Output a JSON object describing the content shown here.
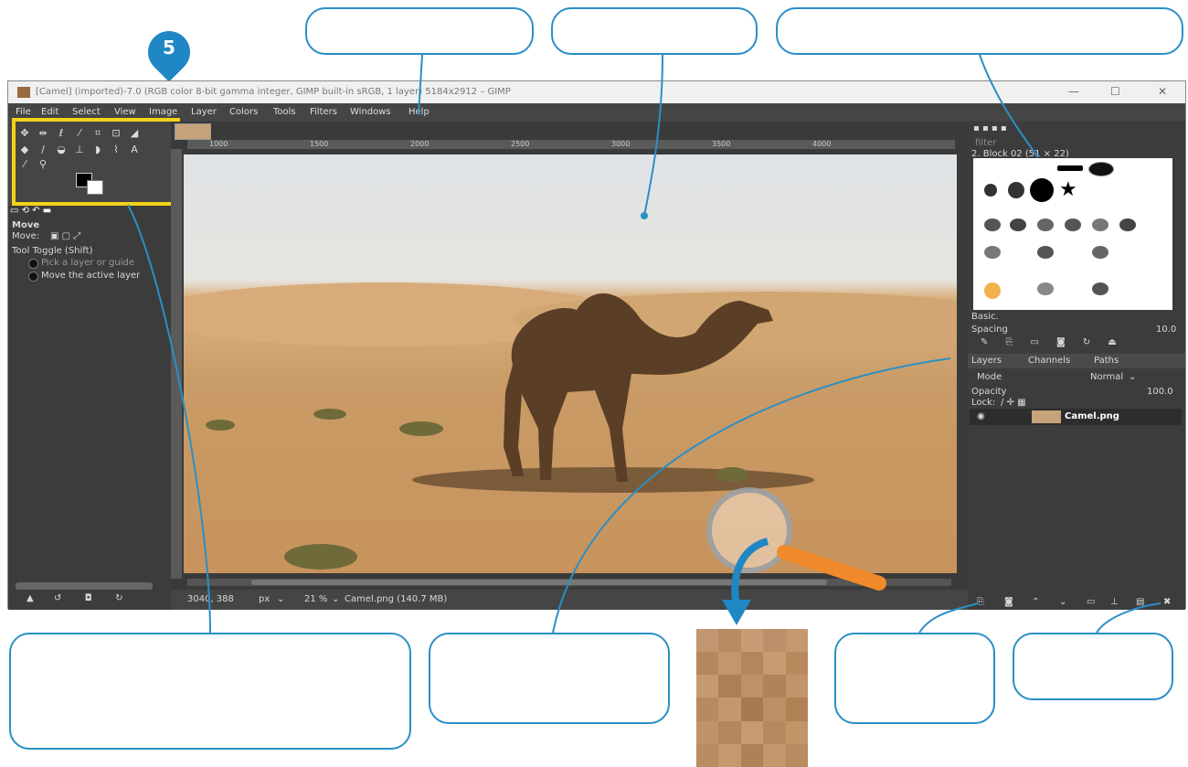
{
  "badge": {
    "number": "5"
  },
  "window": {
    "title": "[Camel] (imported)-7.0 (RGB color 8-bit gamma integer, GIMP built-in sRGB, 1 layer) 5184x2912 – GIMP",
    "controls": {
      "minimize": "—",
      "maximize": "☐",
      "close": "✕"
    }
  },
  "menu": [
    "File",
    "Edit",
    "Select",
    "View",
    "Image",
    "Layer",
    "Colors",
    "Tools",
    "Filters",
    "Windows",
    "Help"
  ],
  "rulers": {
    "h_ticks": [
      "1000",
      "1500",
      "2000",
      "2500",
      "3000",
      "3500",
      "4000"
    ]
  },
  "tool_options": {
    "header": "Move",
    "move_label": "Move:",
    "toggle_label": "Tool Toggle  (Shift)",
    "option1": "Pick a layer or guide",
    "option2": "Move the active layer"
  },
  "status": {
    "coords": "3040, 388",
    "unit": "px",
    "zoom": "21 %",
    "file": "Camel.png (140.7 MB)"
  },
  "brushes": {
    "filter": "filter",
    "current": "2. Block 02 (51 × 22)",
    "preset": "Basic.",
    "spacing_label": "Spacing",
    "spacing_value": "10.0"
  },
  "layers_panel": {
    "tabs": [
      "Layers",
      "Channels",
      "Paths"
    ],
    "mode_label": "Mode",
    "mode_value": "Normal",
    "opacity_label": "Opacity",
    "opacity_value": "100.0",
    "lock_label": "Lock:",
    "layer_name": "Camel.png"
  },
  "colors": {
    "callout_border": "#2a8fc6",
    "toolbox_highlight": "#f2d21a",
    "magnifier_handle": "#f08a2a",
    "gimp_bg": "#454545"
  }
}
